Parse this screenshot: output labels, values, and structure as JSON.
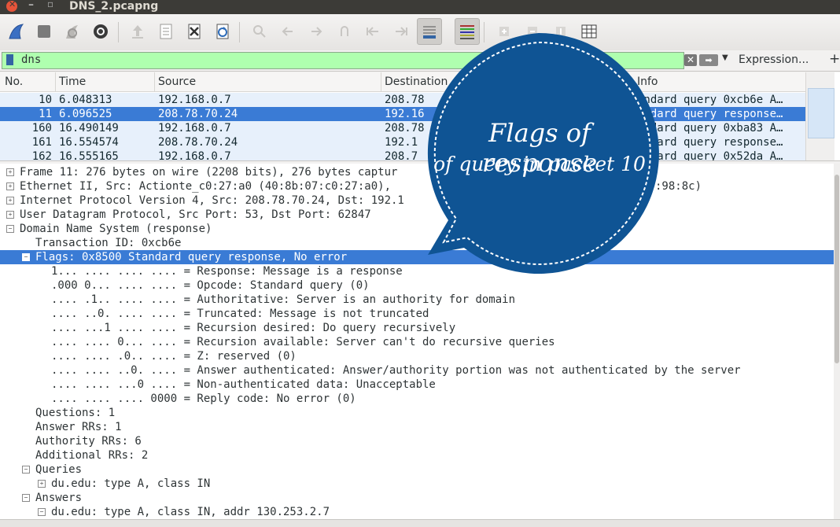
{
  "window": {
    "title": "DNS_2.pcapng",
    "close_glyph": "✕",
    "min_glyph": "–",
    "max_glyph": "▫"
  },
  "toolbar": {
    "icons": [
      "shark-fin-start-icon",
      "stop-icon",
      "restart-icon",
      "options-gear-icon",
      "open-file-icon",
      "save-file-icon",
      "close-file-icon",
      "reload-file-icon",
      "find-icon",
      "back-icon",
      "forward-icon",
      "goto-packet-icon",
      "first-packet-icon",
      "last-packet-icon",
      "autoscroll-icon",
      "colorize-icon",
      "zoom-in-icon",
      "zoom-out-icon",
      "normal-size-icon",
      "resize-columns-icon"
    ]
  },
  "filter": {
    "value": "dns",
    "clear_glyph": "✕",
    "apply_glyph": "➡",
    "dropdown_glyph": "▼",
    "expression_label": "Expression...",
    "add_label": "+"
  },
  "packet_list": {
    "headers": [
      "No.",
      "Time",
      "Source",
      "Destination",
      "Info"
    ],
    "rows": [
      {
        "no": "10",
        "time": "6.048313",
        "source": "192.168.0.7",
        "destination": "208.78",
        "info": "andard query 0xcb6e A…",
        "selected": false
      },
      {
        "no": "11",
        "time": "6.096525",
        "source": "208.78.70.24",
        "destination": "192.16",
        "info": "andard query response…",
        "selected": true
      },
      {
        "no": "160",
        "time": "16.490149",
        "source": "192.168.0.7",
        "destination": "208.78",
        "info": "andard query 0xba83 A…",
        "selected": false
      },
      {
        "no": "161",
        "time": "16.554574",
        "source": "208.78.70.24",
        "destination": "192.1",
        "info": "andard query response…",
        "selected": false
      },
      {
        "no": "162",
        "time": "16.555165",
        "source": "192.168.0.7",
        "destination": "208.7",
        "info": "andard query 0x52da A…",
        "selected": false
      }
    ]
  },
  "details": {
    "lines": [
      {
        "text": "Frame 11: 276 bytes on wire (2208 bits), 276 bytes captur",
        "indent": 0,
        "expander": "+",
        "selected": false
      },
      {
        "text": "Ethernet II, Src: Actionte_c0:27:a0 (40:8b:07:c0:27:a0),",
        "indent": 0,
        "expander": "+",
        "selected": false,
        "tail": ":98:8c)"
      },
      {
        "text": "Internet Protocol Version 4, Src: 208.78.70.24, Dst: 192.1",
        "indent": 0,
        "expander": "+",
        "selected": false
      },
      {
        "text": "User Datagram Protocol, Src Port: 53, Dst Port: 62847",
        "indent": 0,
        "expander": "+",
        "selected": false
      },
      {
        "text": "Domain Name System (response)",
        "indent": 0,
        "expander": "-",
        "selected": false
      },
      {
        "text": "Transaction ID: 0xcb6e",
        "indent": 1,
        "expander": "",
        "selected": false
      },
      {
        "text": "Flags: 0x8500 Standard query response, No error",
        "indent": 1,
        "expander": "-",
        "selected": true
      },
      {
        "text": "1... .... .... .... = Response: Message is a response",
        "indent": 2,
        "expander": "",
        "selected": false
      },
      {
        "text": ".000 0... .... .... = Opcode: Standard query (0)",
        "indent": 2,
        "expander": "",
        "selected": false
      },
      {
        "text": ".... .1.. .... .... = Authoritative: Server is an authority for domain",
        "indent": 2,
        "expander": "",
        "selected": false
      },
      {
        "text": ".... ..0. .... .... = Truncated: Message is not truncated",
        "indent": 2,
        "expander": "",
        "selected": false
      },
      {
        "text": ".... ...1 .... .... = Recursion desired: Do query recursively",
        "indent": 2,
        "expander": "",
        "selected": false
      },
      {
        "text": ".... .... 0... .... = Recursion available: Server can't do recursive queries",
        "indent": 2,
        "expander": "",
        "selected": false
      },
      {
        "text": ".... .... .0.. .... = Z: reserved (0)",
        "indent": 2,
        "expander": "",
        "selected": false
      },
      {
        "text": ".... .... ..0. .... = Answer authenticated: Answer/authority portion was not authenticated by the server",
        "indent": 2,
        "expander": "",
        "selected": false
      },
      {
        "text": ".... .... ...0 .... = Non-authenticated data: Unacceptable",
        "indent": 2,
        "expander": "",
        "selected": false
      },
      {
        "text": ".... .... .... 0000 = Reply code: No error (0)",
        "indent": 2,
        "expander": "",
        "selected": false
      },
      {
        "text": "Questions: 1",
        "indent": 1,
        "expander": "",
        "selected": false
      },
      {
        "text": "Answer RRs: 1",
        "indent": 1,
        "expander": "",
        "selected": false
      },
      {
        "text": "Authority RRs: 6",
        "indent": 1,
        "expander": "",
        "selected": false
      },
      {
        "text": "Additional RRs: 2",
        "indent": 1,
        "expander": "",
        "selected": false
      },
      {
        "text": "Queries",
        "indent": 1,
        "expander": "-",
        "selected": false
      },
      {
        "text": "du.edu: type A, class IN",
        "indent": 2,
        "expander": "+",
        "selected": false
      },
      {
        "text": "Answers",
        "indent": 1,
        "expander": "-",
        "selected": false
      },
      {
        "text": "du.edu: type A, class IN, addr 130.253.2.7",
        "indent": 2,
        "expander": "-",
        "selected": false
      }
    ]
  },
  "callout": {
    "line1": "Flags of response",
    "line2": "of query in packet 10",
    "color": "#0f5494"
  },
  "colors": {
    "selection": "#3a7bd5",
    "row_bg": "#e7f0fb",
    "filter_ok": "#afffaf"
  }
}
